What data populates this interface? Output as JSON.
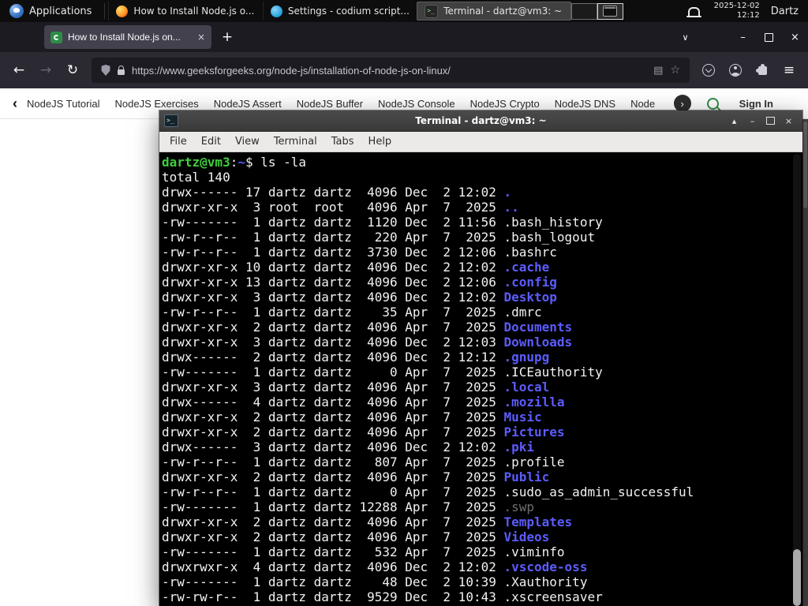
{
  "panel": {
    "applications_label": "Applications",
    "windows": [
      {
        "title": "How to Install Node.js o...",
        "app": "firefox"
      },
      {
        "title": "Settings - codium script...",
        "app": "codium"
      },
      {
        "title": "Terminal - dartz@vm3: ~",
        "app": "terminal"
      }
    ],
    "clock_date": "2025-12-02",
    "clock_time": "12:12",
    "user": "Dartz"
  },
  "browser": {
    "tab_title": "How to Install Node.js on...",
    "tab_close": "×",
    "new_tab": "+",
    "tab_list_chevron": "∨",
    "back": "←",
    "forward": "→",
    "reload": "↻",
    "url": "https://www.geeksforgeeks.org/node-js/installation-of-node-js-on-linux/",
    "reader": "▤",
    "star": "☆",
    "menu_glyph": "≡",
    "minimize": "–",
    "close": "×"
  },
  "site_nav": {
    "back_chevron": "‹",
    "items": [
      "NodeJS Tutorial",
      "NodeJS Exercises",
      "NodeJS Assert",
      "NodeJS Buffer",
      "NodeJS Console",
      "NodeJS Crypto",
      "NodeJS DNS",
      "Node"
    ],
    "more_chevron": "›",
    "sign_in": "Sign In"
  },
  "terminal": {
    "title": "Terminal - dartz@vm3: ~",
    "menu": [
      "File",
      "Edit",
      "View",
      "Terminal",
      "Tabs",
      "Help"
    ],
    "window_buttons": {
      "shade": "▴",
      "minimize": "–",
      "close": "×"
    },
    "prompt": {
      "user_host": "dartz@vm3",
      "colon": ":",
      "cwd": "~",
      "dollar": "$ ",
      "command": "ls -la"
    },
    "total_line": "total 140",
    "listing": [
      {
        "perms": "drwx------",
        "links": "17",
        "owner": "dartz",
        "group": "dartz",
        "size": "4096",
        "month": "Dec",
        "day": "2",
        "when": "12:02",
        "name": ".",
        "type": "dir"
      },
      {
        "perms": "drwxr-xr-x",
        "links": "3",
        "owner": "root",
        "group": "root",
        "size": "4096",
        "month": "Apr",
        "day": "7",
        "when": "2025",
        "name": "..",
        "type": "dir"
      },
      {
        "perms": "-rw-------",
        "links": "1",
        "owner": "dartz",
        "group": "dartz",
        "size": "1120",
        "month": "Dec",
        "day": "2",
        "when": "11:56",
        "name": ".bash_history",
        "type": "file"
      },
      {
        "perms": "-rw-r--r--",
        "links": "1",
        "owner": "dartz",
        "group": "dartz",
        "size": "220",
        "month": "Apr",
        "day": "7",
        "when": "2025",
        "name": ".bash_logout",
        "type": "file"
      },
      {
        "perms": "-rw-r--r--",
        "links": "1",
        "owner": "dartz",
        "group": "dartz",
        "size": "3730",
        "month": "Dec",
        "day": "2",
        "when": "12:06",
        "name": ".bashrc",
        "type": "file"
      },
      {
        "perms": "drwxr-xr-x",
        "links": "10",
        "owner": "dartz",
        "group": "dartz",
        "size": "4096",
        "month": "Dec",
        "day": "2",
        "when": "12:02",
        "name": ".cache",
        "type": "dir"
      },
      {
        "perms": "drwxr-xr-x",
        "links": "13",
        "owner": "dartz",
        "group": "dartz",
        "size": "4096",
        "month": "Dec",
        "day": "2",
        "when": "12:06",
        "name": ".config",
        "type": "dir"
      },
      {
        "perms": "drwxr-xr-x",
        "links": "3",
        "owner": "dartz",
        "group": "dartz",
        "size": "4096",
        "month": "Dec",
        "day": "2",
        "when": "12:02",
        "name": "Desktop",
        "type": "dir"
      },
      {
        "perms": "-rw-r--r--",
        "links": "1",
        "owner": "dartz",
        "group": "dartz",
        "size": "35",
        "month": "Apr",
        "day": "7",
        "when": "2025",
        "name": ".dmrc",
        "type": "file"
      },
      {
        "perms": "drwxr-xr-x",
        "links": "2",
        "owner": "dartz",
        "group": "dartz",
        "size": "4096",
        "month": "Apr",
        "day": "7",
        "when": "2025",
        "name": "Documents",
        "type": "dir"
      },
      {
        "perms": "drwxr-xr-x",
        "links": "3",
        "owner": "dartz",
        "group": "dartz",
        "size": "4096",
        "month": "Dec",
        "day": "2",
        "when": "12:03",
        "name": "Downloads",
        "type": "dir"
      },
      {
        "perms": "drwx------",
        "links": "2",
        "owner": "dartz",
        "group": "dartz",
        "size": "4096",
        "month": "Dec",
        "day": "2",
        "when": "12:12",
        "name": ".gnupg",
        "type": "dir"
      },
      {
        "perms": "-rw-------",
        "links": "1",
        "owner": "dartz",
        "group": "dartz",
        "size": "0",
        "month": "Apr",
        "day": "7",
        "when": "2025",
        "name": ".ICEauthority",
        "type": "file"
      },
      {
        "perms": "drwxr-xr-x",
        "links": "3",
        "owner": "dartz",
        "group": "dartz",
        "size": "4096",
        "month": "Apr",
        "day": "7",
        "when": "2025",
        "name": ".local",
        "type": "dir"
      },
      {
        "perms": "drwx------",
        "links": "4",
        "owner": "dartz",
        "group": "dartz",
        "size": "4096",
        "month": "Apr",
        "day": "7",
        "when": "2025",
        "name": ".mozilla",
        "type": "dir"
      },
      {
        "perms": "drwxr-xr-x",
        "links": "2",
        "owner": "dartz",
        "group": "dartz",
        "size": "4096",
        "month": "Apr",
        "day": "7",
        "when": "2025",
        "name": "Music",
        "type": "dir"
      },
      {
        "perms": "drwxr-xr-x",
        "links": "2",
        "owner": "dartz",
        "group": "dartz",
        "size": "4096",
        "month": "Apr",
        "day": "7",
        "when": "2025",
        "name": "Pictures",
        "type": "dir"
      },
      {
        "perms": "drwx------",
        "links": "3",
        "owner": "dartz",
        "group": "dartz",
        "size": "4096",
        "month": "Dec",
        "day": "2",
        "when": "12:02",
        "name": ".pki",
        "type": "dir"
      },
      {
        "perms": "-rw-r--r--",
        "links": "1",
        "owner": "dartz",
        "group": "dartz",
        "size": "807",
        "month": "Apr",
        "day": "7",
        "when": "2025",
        "name": ".profile",
        "type": "file"
      },
      {
        "perms": "drwxr-xr-x",
        "links": "2",
        "owner": "dartz",
        "group": "dartz",
        "size": "4096",
        "month": "Apr",
        "day": "7",
        "when": "2025",
        "name": "Public",
        "type": "dir"
      },
      {
        "perms": "-rw-r--r--",
        "links": "1",
        "owner": "dartz",
        "group": "dartz",
        "size": "0",
        "month": "Apr",
        "day": "7",
        "when": "2025",
        "name": ".sudo_as_admin_successful",
        "type": "file"
      },
      {
        "perms": "-rw-------",
        "links": "1",
        "owner": "dartz",
        "group": "dartz",
        "size": "12288",
        "month": "Apr",
        "day": "7",
        "when": "2025",
        "name": ".swp",
        "type": "dim"
      },
      {
        "perms": "drwxr-xr-x",
        "links": "2",
        "owner": "dartz",
        "group": "dartz",
        "size": "4096",
        "month": "Apr",
        "day": "7",
        "when": "2025",
        "name": "Templates",
        "type": "dir"
      },
      {
        "perms": "drwxr-xr-x",
        "links": "2",
        "owner": "dartz",
        "group": "dartz",
        "size": "4096",
        "month": "Apr",
        "day": "7",
        "when": "2025",
        "name": "Videos",
        "type": "dir"
      },
      {
        "perms": "-rw-------",
        "links": "1",
        "owner": "dartz",
        "group": "dartz",
        "size": "532",
        "month": "Apr",
        "day": "7",
        "when": "2025",
        "name": ".viminfo",
        "type": "file"
      },
      {
        "perms": "drwxrwxr-x",
        "links": "4",
        "owner": "dartz",
        "group": "dartz",
        "size": "4096",
        "month": "Dec",
        "day": "2",
        "when": "12:02",
        "name": ".vscode-oss",
        "type": "dir"
      },
      {
        "perms": "-rw-------",
        "links": "1",
        "owner": "dartz",
        "group": "dartz",
        "size": "48",
        "month": "Dec",
        "day": "2",
        "when": "10:39",
        "name": ".Xauthority",
        "type": "file"
      },
      {
        "perms": "-rw-rw-r--",
        "links": "1",
        "owner": "dartz",
        "group": "dartz",
        "size": "9529",
        "month": "Dec",
        "day": "2",
        "when": "10:43",
        "name": ".xscreensaver",
        "type": "file"
      }
    ]
  },
  "colors": {
    "prompt_green": "#3ecf3e",
    "directory_blue": "#5c5cff",
    "gfg_green": "#2f8d46",
    "terminal_background": "#000000"
  }
}
